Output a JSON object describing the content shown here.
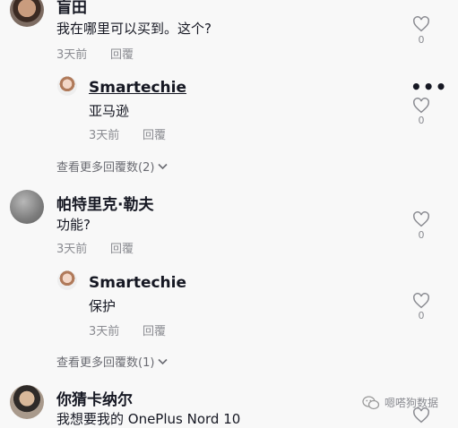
{
  "comments": [
    {
      "author": "盲田",
      "text": "我在哪里可以买到。这个?",
      "time": "3天前",
      "reply_label": "回覆",
      "likes": "0",
      "replies": [
        {
          "author": "Smartechie",
          "text": "亚马逊",
          "time": "3天前",
          "reply_label": "回覆",
          "likes": "0"
        }
      ],
      "view_more": "查看更多回覆数(2)"
    },
    {
      "author": "帕特里克·勒夫",
      "text": "功能?",
      "time": "3天前",
      "reply_label": "回覆",
      "likes": "0",
      "replies": [
        {
          "author": "Smartechie",
          "text": "保护",
          "time": "3天前",
          "reply_label": "回覆",
          "likes": "0"
        }
      ],
      "view_more": "查看更多回覆数(1)"
    },
    {
      "author": "你猜卡纳尔",
      "text": "我想要我的 OnePlus Nord 10"
    }
  ],
  "more_menu": "•••",
  "watermark": "嗯嗒狗数据",
  "icons": {
    "like": "heart-outline-icon",
    "expand": "chevron-down-icon",
    "more": "more-options-icon",
    "watermark": "wechat-logo-icon"
  },
  "colors": {
    "background": "#f8f8f8",
    "text": "#161823",
    "muted": "#8a8b91"
  }
}
